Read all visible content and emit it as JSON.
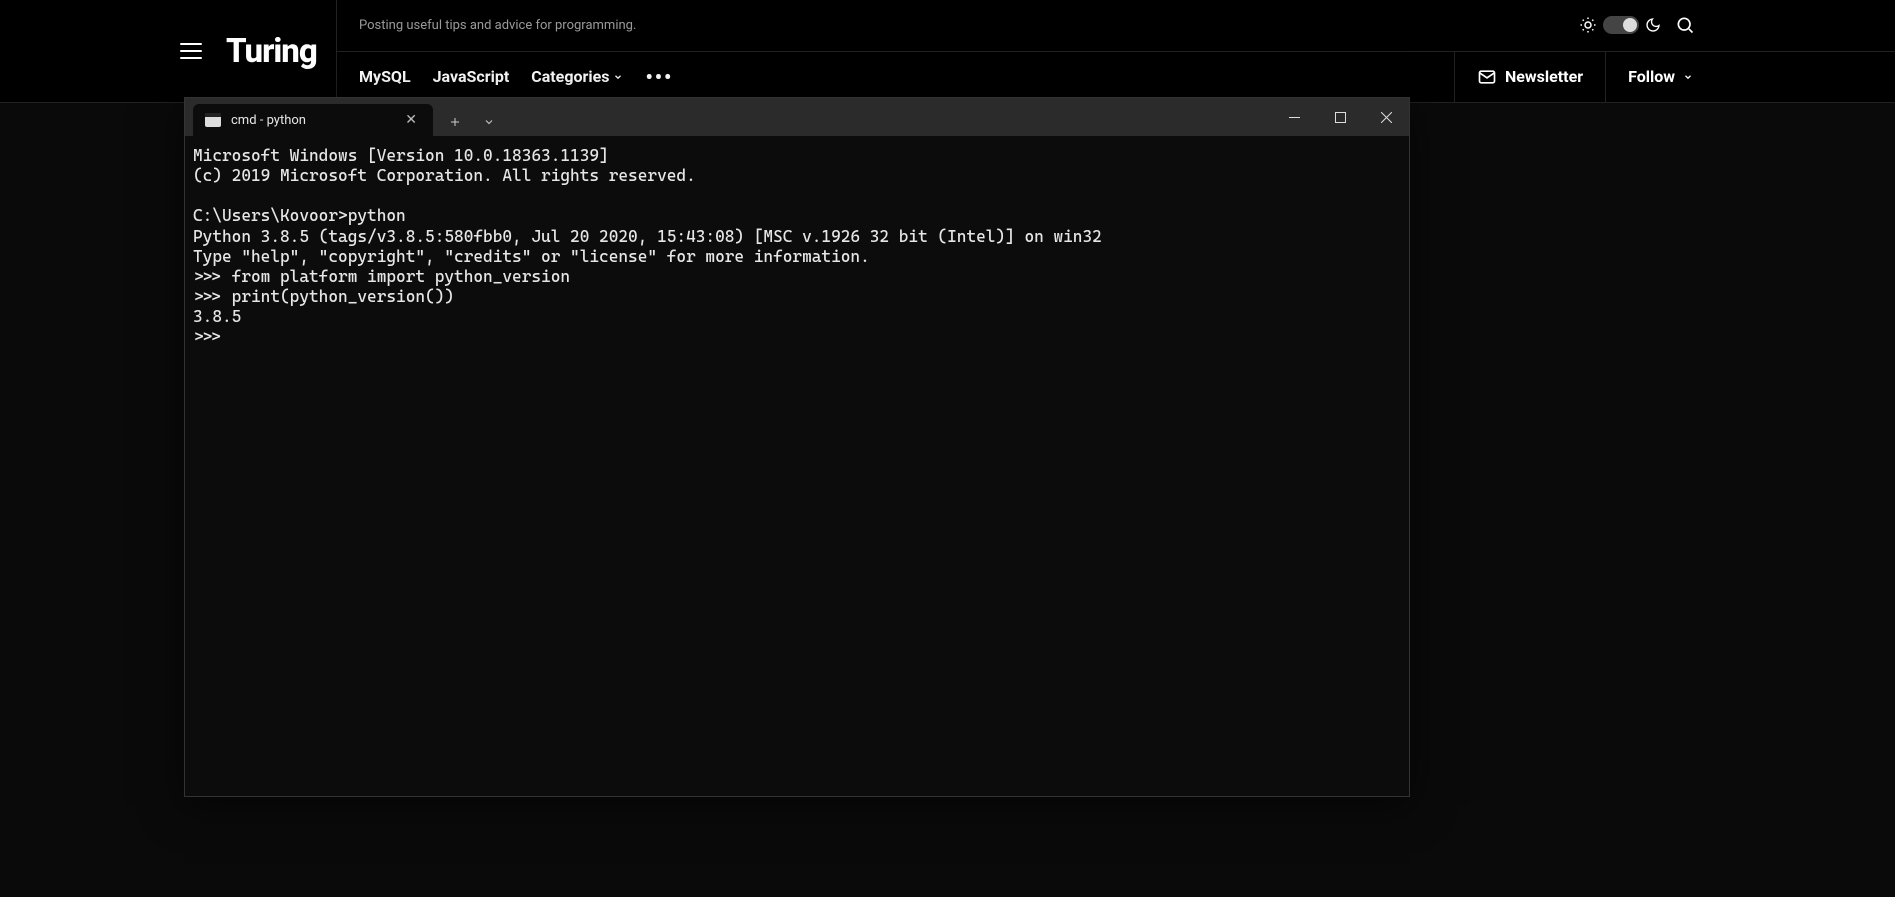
{
  "site": {
    "logo": "Turing",
    "tagline": "Posting useful tips and advice for programming.",
    "nav": {
      "items": [
        "MySQL",
        "JavaScript",
        "Categories"
      ],
      "more": "•••"
    },
    "newsletter": "Newsletter",
    "follow": "Follow"
  },
  "terminal": {
    "tab_title": "cmd - python",
    "lines": [
      "Microsoft Windows [Version 10.0.18363.1139]",
      "(c) 2019 Microsoft Corporation. All rights reserved.",
      "",
      "C:\\Users\\Kovoor>python",
      "Python 3.8.5 (tags/v3.8.5:580fbb0, Jul 20 2020, 15:43:08) [MSC v.1926 32 bit (Intel)] on win32",
      "Type \"help\", \"copyright\", \"credits\" or \"license\" for more information.",
      ">>> from platform import python_version",
      ">>> print(python_version())",
      "3.8.5",
      ">>>"
    ]
  }
}
